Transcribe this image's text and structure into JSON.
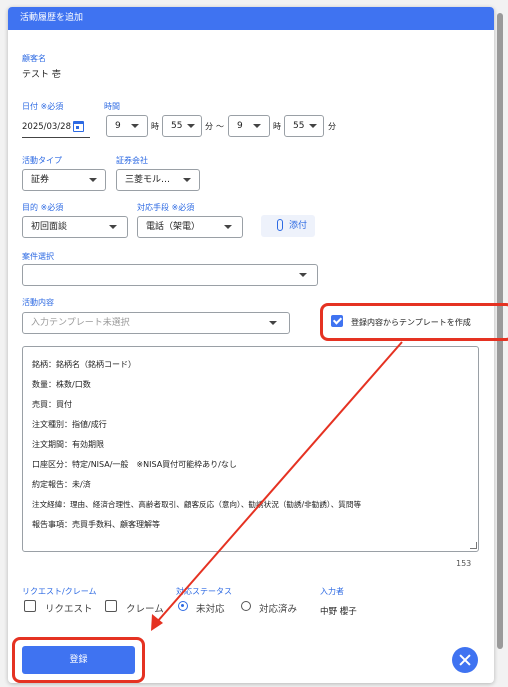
{
  "dialog": {
    "title": "活動履歴を追加"
  },
  "customer": {
    "label": "顧客名",
    "value": "テスト 壱"
  },
  "date": {
    "label": "日付 ※必須",
    "value": "2025/03/28"
  },
  "time": {
    "label": "時間",
    "start_hour": "9",
    "start_minute": "55",
    "end_hour": "9",
    "end_minute": "55",
    "hour_unit": "時",
    "minute_unit": "分",
    "tilde": "〜"
  },
  "activity_type": {
    "label": "活動タイプ",
    "value": "証券"
  },
  "securities_company": {
    "label": "証券会社",
    "value": "三菱モル…"
  },
  "purpose": {
    "label": "目的 ※必須",
    "value": "初回面談"
  },
  "method": {
    "label": "対応手段 ※必須",
    "value": "電話（架電）"
  },
  "attach_button": {
    "label": "添付"
  },
  "case": {
    "label": "案件選択",
    "value": ""
  },
  "activity_content": {
    "label": "活動内容",
    "template_placeholder": "入力テンプレート未選択",
    "create_template_label": "登録内容からテンプレートを作成",
    "lines": [
      "銘柄：銘柄名（銘柄コード）",
      "数量：株数/口数",
      "売買：買付",
      "注文種別：指値/成行",
      "注文期間：有効期限",
      "口座区分：特定/NISA/一般　※NISA買付可能枠あり/なし",
      "約定報告：未/済",
      "注文経緯：理由、経済合理性、高齢者取引、顧客反応（意向）、勧誘状況（勧誘/非勧誘）、質問等",
      "報告事項：売買手数料、顧客理解等"
    ],
    "char_count": "153"
  },
  "request_claim": {
    "label": "リクエスト/クレーム",
    "options": [
      "リクエスト",
      "クレーム"
    ]
  },
  "status": {
    "label": "対応ステータス",
    "options": [
      "未対応",
      "対応済み"
    ],
    "selected": "未対応"
  },
  "inputter": {
    "label": "入力者",
    "value": "中野 櫻子"
  },
  "submit": {
    "label": "登録"
  },
  "colors": {
    "accent": "#3f73f1",
    "annotation": "#e53222"
  }
}
